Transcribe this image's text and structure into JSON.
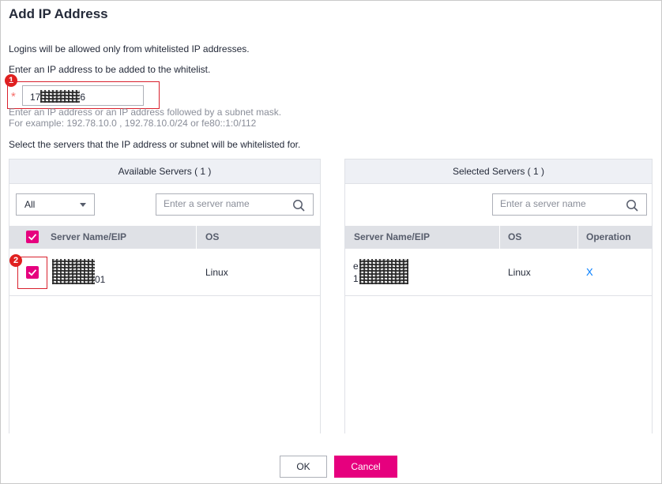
{
  "dialog": {
    "title": "Add IP Address",
    "intro": "Logins will be allowed only from whitelisted IP addresses.",
    "ip_prompt": "Enter an IP address to be added to the whitelist.",
    "required_mark": "*",
    "ip_value_prefix": "17",
    "ip_value_suffix": "6",
    "ip_hint_line1": "Enter an IP address or an IP address followed by a subnet mask.",
    "ip_hint_line2": "For example: 192.78.10.0 , 192.78.10.0/24 or fe80::1:0/112",
    "servers_prompt": "Select the servers that the IP address or subnet will be whitelisted for."
  },
  "callouts": {
    "one": "1",
    "two": "2"
  },
  "available": {
    "title": "Available Servers ( 1 )",
    "filter_value": "All",
    "search_placeholder": "Enter a server name",
    "col_name": "Server Name/EIP",
    "col_os": "OS",
    "rows": [
      {
        "name_suffix": "01",
        "os": "Linux",
        "checked": true
      }
    ]
  },
  "selected": {
    "title": "Selected Servers ( 1 )",
    "search_placeholder": "Enter a server name",
    "col_name": "Server Name/EIP",
    "col_os": "OS",
    "col_op": "Operation",
    "rows": [
      {
        "name_line1_prefix": "e",
        "name_line2_prefix": "1",
        "os": "Linux",
        "remove": "X"
      }
    ]
  },
  "footer": {
    "ok_label": "OK",
    "cancel_label": "Cancel"
  },
  "colors": {
    "accent": "#e6007e",
    "callout": "#e0201f",
    "link": "#007dff",
    "header_bg": "#eef0f5"
  },
  "icons": [
    "search-icon",
    "chevron-down-icon",
    "checkbox-checked-icon",
    "close-icon"
  ]
}
